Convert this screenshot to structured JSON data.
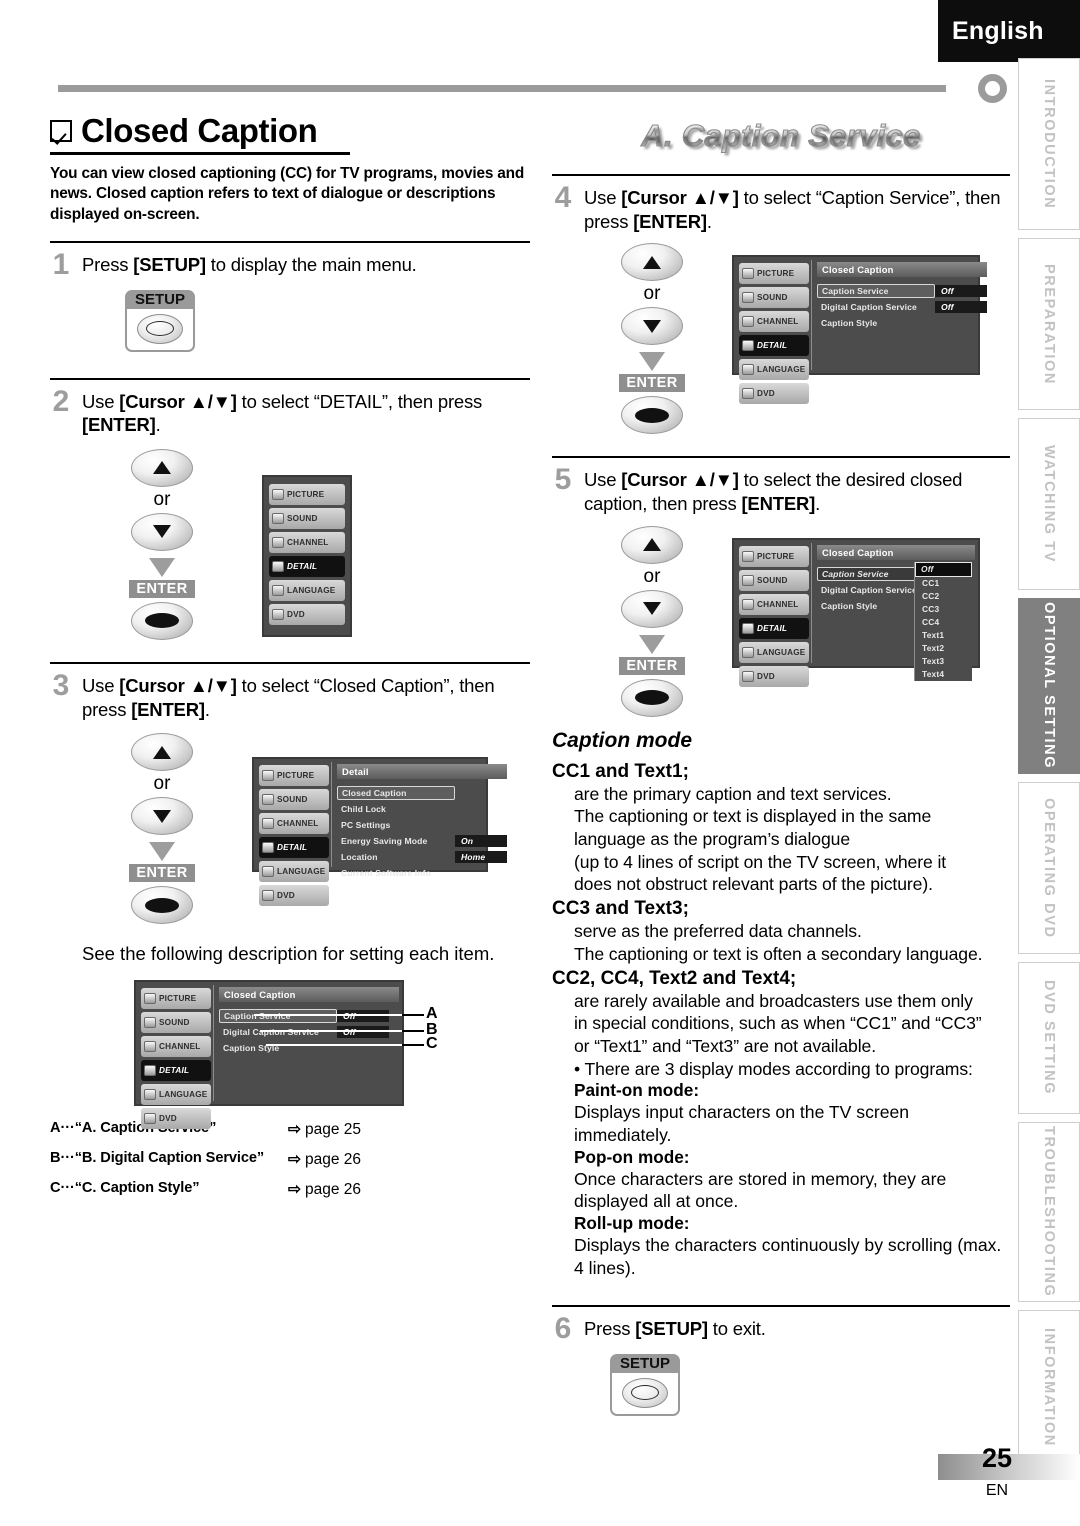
{
  "header": {
    "language": "English"
  },
  "rail": {
    "tabs": [
      {
        "label": "INTRODUCTION",
        "active": false
      },
      {
        "label": "PREPARATION",
        "active": false
      },
      {
        "label": "WATCHING  TV",
        "active": false
      },
      {
        "label": "OPTIONAL  SETTING",
        "active": true
      },
      {
        "label": "OPERATING  DVD",
        "active": false
      },
      {
        "label": "DVD  SETTING",
        "active": false
      },
      {
        "label": "TROUBLESHOOTING",
        "active": false
      },
      {
        "label": "INFORMATION",
        "active": false
      }
    ]
  },
  "left": {
    "title": "Closed Caption",
    "lede": "You can view closed captioning (CC) for TV programs, movies and news. Closed caption refers to text of dialogue or descriptions displayed on-screen.",
    "step1": {
      "num": "1",
      "pre": "Press ",
      "key": "[SETUP]",
      "post": " to display the main menu.",
      "setup_label": "SETUP"
    },
    "step2": {
      "num": "2",
      "pre": "Use ",
      "key1": "[Cursor ▲/▼]",
      "mid": " to select “DETAIL”, then press ",
      "key2": "[ENTER]",
      "post": ".",
      "or": "or",
      "enter": "ENTER"
    },
    "step3": {
      "num": "3",
      "pre": "Use ",
      "key1": "[Cursor ▲/▼]",
      "mid": " to select “Closed Caption”, then press ",
      "key2": "[ENTER]",
      "post": ".",
      "or": "or",
      "enter": "ENTER"
    },
    "note": "See the following description for setting each item.",
    "menu_main": {
      "items": [
        "PICTURE",
        "SOUND",
        "CHANNEL",
        "DETAIL",
        "LANGUAGE",
        "DVD"
      ],
      "selected": "DETAIL"
    },
    "menu_detail": {
      "title": "Detail",
      "side": [
        "PICTURE",
        "SOUND",
        "CHANNEL",
        "DETAIL",
        "LANGUAGE",
        "DVD"
      ],
      "selected_side": "DETAIL",
      "rows": [
        {
          "label": "Closed Caption",
          "value": "",
          "highlight": true
        },
        {
          "label": "Child Lock",
          "value": ""
        },
        {
          "label": "PC Settings",
          "value": ""
        },
        {
          "label": "Energy Saving Mode",
          "value": "On"
        },
        {
          "label": "Location",
          "value": "Home"
        },
        {
          "label": "Current Software Info",
          "value": ""
        }
      ]
    },
    "menu_cc": {
      "title": "Closed Caption",
      "side": [
        "PICTURE",
        "SOUND",
        "CHANNEL",
        "DETAIL",
        "LANGUAGE",
        "DVD"
      ],
      "selected_side": "DETAIL",
      "rows": [
        {
          "label": "Caption Service",
          "value": "Off",
          "highlight": true
        },
        {
          "label": "Digital Caption Service",
          "value": "Off"
        },
        {
          "label": "Caption Style",
          "value": ""
        }
      ],
      "callouts": [
        "A",
        "B",
        "C"
      ]
    },
    "legend": [
      {
        "key": "A···“A. Caption Service”",
        "page": "page 25"
      },
      {
        "key": "B···“B. Digital Caption Service”",
        "page": "page 26"
      },
      {
        "key": "C···“C. Caption Style”",
        "page": "page 26"
      }
    ]
  },
  "right": {
    "banner": "A.  Caption Service",
    "step4": {
      "num": "4",
      "pre": "Use ",
      "key1": "[Cursor ▲/▼]",
      "mid": " to select “Caption Service”, then press ",
      "key2": "[ENTER]",
      "post": ".",
      "or": "or",
      "enter": "ENTER"
    },
    "step5": {
      "num": "5",
      "pre": "Use ",
      "key1": "[Cursor ▲/▼]",
      "mid": " to select the desired closed caption, then press ",
      "key2": "[ENTER]",
      "post": ".",
      "or": "or",
      "enter": "ENTER"
    },
    "step6": {
      "num": "6",
      "pre": "Press ",
      "key": "[SETUP]",
      "post": " to exit.",
      "setup_label": "SETUP"
    },
    "menu_cc4": {
      "title": "Closed Caption",
      "side": [
        "PICTURE",
        "SOUND",
        "CHANNEL",
        "DETAIL",
        "LANGUAGE",
        "DVD"
      ],
      "selected_side": "DETAIL",
      "rows": [
        {
          "label": "Caption Service",
          "value": "Off",
          "highlight": true
        },
        {
          "label": "Digital Caption Service",
          "value": "Off"
        },
        {
          "label": "Caption Style",
          "value": ""
        }
      ]
    },
    "menu_cc5": {
      "title": "Closed Caption",
      "side": [
        "PICTURE",
        "SOUND",
        "CHANNEL",
        "DETAIL",
        "LANGUAGE",
        "DVD"
      ],
      "selected_side": "DETAIL",
      "rows": [
        {
          "label": "Caption Service",
          "highlight": true
        },
        {
          "label": "Digital Caption Service"
        },
        {
          "label": "Caption Style"
        }
      ],
      "dropdown": [
        "Off",
        "CC1",
        "CC2",
        "CC3",
        "CC4",
        "Text1",
        "Text2",
        "Text3",
        "Text4"
      ],
      "dropdown_selected": "Off"
    },
    "caption_mode": {
      "heading": "Caption mode",
      "blocks": [
        {
          "head": "CC1 and Text1;",
          "lines": [
            "are the primary caption and text services.",
            "The captioning or text is displayed in the same",
            "language as the program’s dialogue",
            "(up to 4 lines of script on the TV screen, where it",
            "does not obstruct relevant parts of the picture)."
          ]
        },
        {
          "head": "CC3 and Text3;",
          "lines": [
            "serve as the preferred data channels.",
            "The captioning or text is often a secondary language."
          ]
        },
        {
          "head": "CC2, CC4, Text2 and Text4;",
          "lines": [
            "are rarely available and broadcasters use them only",
            "in special conditions, such as when “CC1” and “CC3”",
            "or “Text1” and “Text3” are not available."
          ]
        }
      ],
      "bullet": "•   There are 3 display modes according to programs:",
      "modes": [
        {
          "name": "Paint-on mode:",
          "desc": "Displays input characters on the TV screen immediately."
        },
        {
          "name": "Pop-on mode:",
          "desc": "Once characters are stored in memory, they are displayed all at once."
        },
        {
          "name": "Roll-up mode:",
          "desc": "Displays the characters continuously by scrolling (max. 4 lines)."
        }
      ]
    }
  },
  "footer": {
    "page": "25",
    "lang_code": "EN"
  }
}
